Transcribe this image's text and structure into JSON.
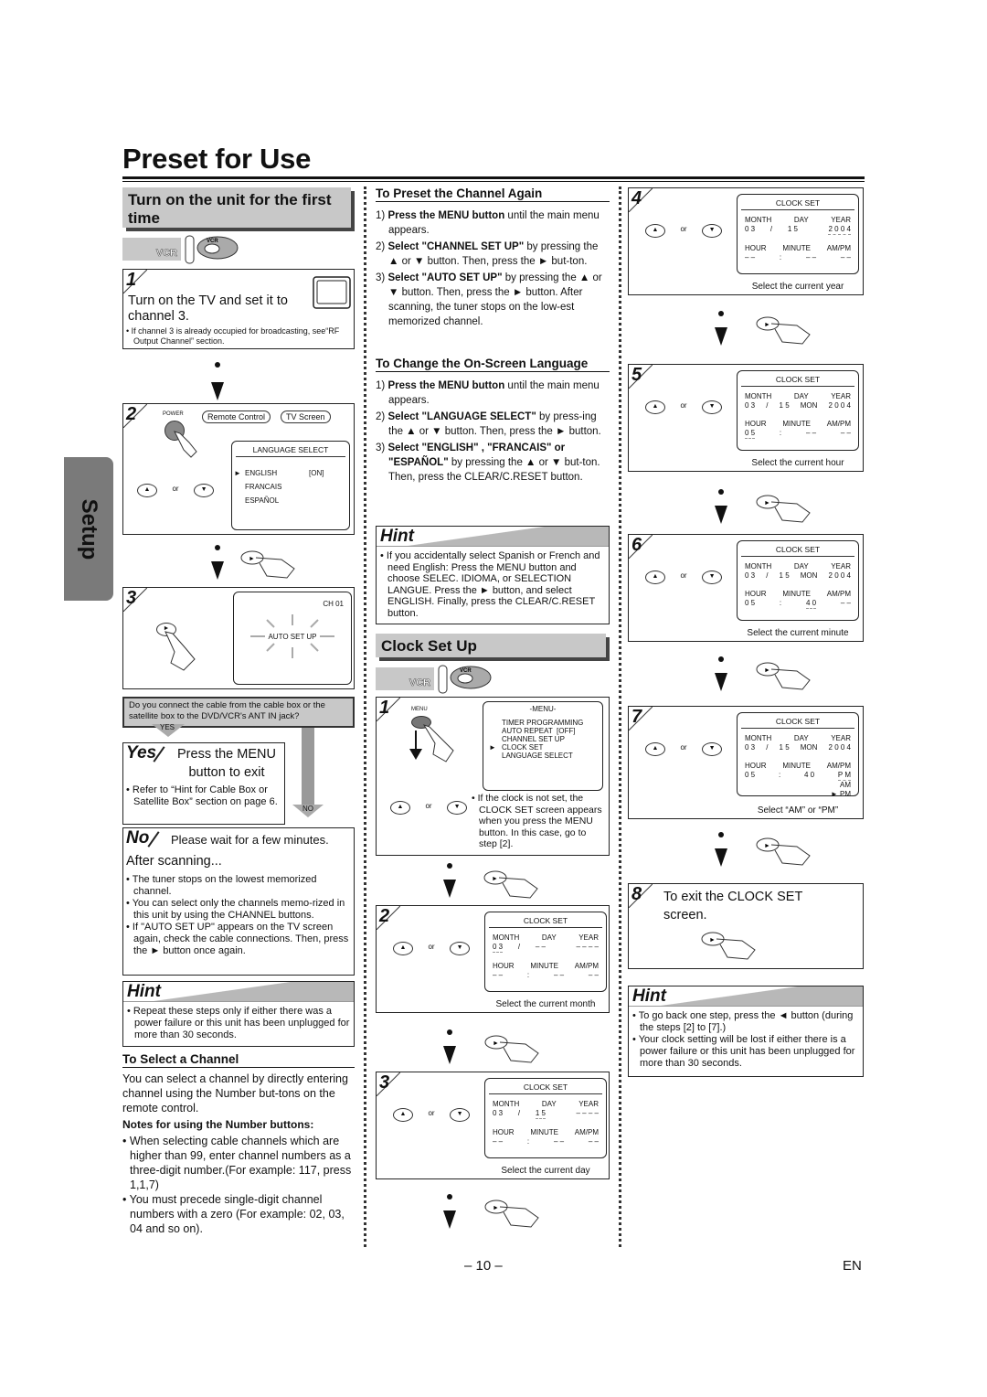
{
  "page_title": "Preset for Use",
  "side_tab": "Setup",
  "footer": {
    "page_number": "– 10 –",
    "language": "EN"
  },
  "col1": {
    "section_title": "Turn on the unit for the first time",
    "mode_icons": {
      "vcr": "VCR",
      "remote_label": "VCR"
    },
    "step1": {
      "num": "1",
      "text": "Turn on the TV and set it to channel 3.",
      "note": "If channel 3 is already occupied for broadcasting, see“RF Output Channel” section."
    },
    "step2": {
      "num": "2",
      "power_label": "POWER",
      "bubble_remote": "Remote Control",
      "bubble_tv": "TV Screen",
      "or": "or",
      "screen_title": "LANGUAGE SELECT",
      "options": [
        {
          "label": "ENGLISH",
          "status": "[ON]",
          "selected": true
        },
        {
          "label": "FRANCAIS",
          "status": "",
          "selected": false
        },
        {
          "label": "ESPAÑOL",
          "status": "",
          "selected": false
        }
      ]
    },
    "step3": {
      "num": "3",
      "channel": "CH 01",
      "screen_text": "AUTO SET UP"
    },
    "question": "Do you connect the cable from the cable box or the satellite box to the DVD/VCR's ANT IN jack?",
    "yes_label": "YES",
    "no_label": "NO",
    "yes_box": {
      "tag": "Yes",
      "text": "Press the MENU button to exit",
      "note": "Refer to “Hint for Cable Box or Satellite Box” section on page 6."
    },
    "no_box": {
      "tag": "No",
      "text": "Please wait for a few minutes.",
      "after": "After scanning...",
      "notes": [
        "The tuner stops on the lowest memorized channel.",
        "You can select only the channels memo-rized in this unit by using the CHANNEL buttons.",
        "If \"AUTO SET UP\" appears on the TV screen again, check the cable connections. Then, press the ► button once again."
      ]
    },
    "hint": {
      "title": "Hint",
      "items": [
        "Repeat these steps only if either there was a power failure or this unit has been unplugged for more than 30 seconds."
      ]
    },
    "select_channel": {
      "title": "To Select a Channel",
      "text": "You can select a channel by directly entering channel using the Number but-tons on the remote control.",
      "notes_title": "Notes for using the Number buttons:",
      "notes": [
        "When selecting cable channels which are higher than 99, enter channel numbers as a three-digit number.(For example: 117, press 1,1,7)",
        "You must precede single-digit channel numbers with a zero (For example: 02, 03, 04 and so on)."
      ]
    }
  },
  "col2": {
    "preset_again": {
      "title": "To Preset the Channel Again",
      "steps": [
        {
          "n": "1)",
          "bold": "Press the MENU button",
          "rest": " until the main menu appears."
        },
        {
          "n": "2)",
          "bold": "Select \"CHANNEL SET UP\"",
          "rest": " by pressing the ▲ or ▼ button. Then, press the ► but-ton."
        },
        {
          "n": "3)",
          "bold": "Select \"AUTO SET UP\"",
          "rest": " by pressing the ▲ or ▼ button. Then, press the ► button. After scanning, the tuner stops on the low-est memorized channel."
        }
      ]
    },
    "language": {
      "title": "To Change the On-Screen Language",
      "steps": [
        {
          "n": "1)",
          "bold": "Press the MENU button",
          "rest": " until the main menu appears."
        },
        {
          "n": "2)",
          "bold": "Select \"LANGUAGE SELECT\"",
          "rest": " by press-ing the ▲ or ▼ button. Then, press the ► button."
        },
        {
          "n": "3)",
          "bold": "Select \"ENGLISH\" , \"FRANCAIS\" or \"ESPAÑOL\"",
          "rest": " by pressing the ▲ or ▼ but-ton. Then, press the CLEAR/C.RESET button."
        }
      ]
    },
    "hint": {
      "title": "Hint",
      "items": [
        "If you accidentally select Spanish or French and need English: Press the MENU button and choose SELEC. IDIOMA, or SELECTION LANGUE. Press the ► button, and select ENGLISH. Finally, press the CLEAR/C.RESET button."
      ]
    },
    "clock_title": "Clock Set Up",
    "mode_icons": {
      "vcr": "VCR",
      "remote_label": "VCR"
    },
    "step1": {
      "num": "1",
      "menu_label": "MENU",
      "or": "or",
      "screen_title": "-MENU-",
      "menu_items": [
        {
          "label": "TIMER PROGRAMMING",
          "selected": false
        },
        {
          "label": "AUTO REPEAT  [OFF]",
          "selected": false
        },
        {
          "label": "CHANNEL SET UP",
          "selected": false
        },
        {
          "label": "CLOCK SET",
          "selected": true
        },
        {
          "label": "LANGUAGE SELECT",
          "selected": false
        }
      ],
      "note": "If the clock is not set, the CLOCK SET screen appears when you press the MENU button. In this case, go to step [2]."
    },
    "step2": {
      "num": "2",
      "caption": "Select the current month",
      "month": "0 3",
      "day": "– –",
      "year": "– – – –",
      "weekday": "",
      "hour": "– –",
      "minute": "– –",
      "ampm": "– –"
    },
    "step3": {
      "num": "3",
      "caption": "Select the current day",
      "month": "0 3",
      "day": "1 5",
      "year": "– – – –",
      "weekday": "",
      "hour": "– –",
      "minute": "– –",
      "ampm": "– –"
    }
  },
  "col3": {
    "clock_labels": {
      "title": "CLOCK SET",
      "month": "MONTH",
      "day": "DAY",
      "year": "YEAR",
      "hour": "HOUR",
      "minute": "MINUTE",
      "ampm": "AM/PM",
      "or": "or"
    },
    "step4": {
      "num": "4",
      "caption": "Select the current year",
      "month": "0 3",
      "day": "1 5",
      "weekday": "",
      "year": "2 0 0 4",
      "hour": "– –",
      "minute": "– –",
      "ampm": "– –"
    },
    "step5": {
      "num": "5",
      "caption": "Select the current hour",
      "month": "0 3",
      "day": "1 5",
      "weekday": "MON",
      "year": "2 0 0 4",
      "hour": "0 5",
      "minute": "– –",
      "ampm": "– –"
    },
    "step6": {
      "num": "6",
      "caption": "Select the current minute",
      "month": "0 3",
      "day": "1 5",
      "weekday": "MON",
      "year": "2 0 0 4",
      "hour": "0 5",
      "minute": "4 0",
      "ampm": "– –"
    },
    "step7": {
      "num": "7",
      "caption": "Select “AM” or “PM”",
      "month": "0 3",
      "day": "1 5",
      "weekday": "MON",
      "year": "2 0 0 4",
      "hour": "0 5",
      "minute": "4 0",
      "ampm": "P M",
      "opt_am": "AM",
      "opt_pm": "PM"
    },
    "step8": {
      "num": "8",
      "text": "To exit the CLOCK SET screen."
    },
    "hint": {
      "title": "Hint",
      "items": [
        "To go back one step, press the ◄ button (during the steps [2] to [7].)",
        "Your clock setting will be lost if either there is a power failure or this unit has been unplugged for more than 30 seconds."
      ]
    }
  }
}
